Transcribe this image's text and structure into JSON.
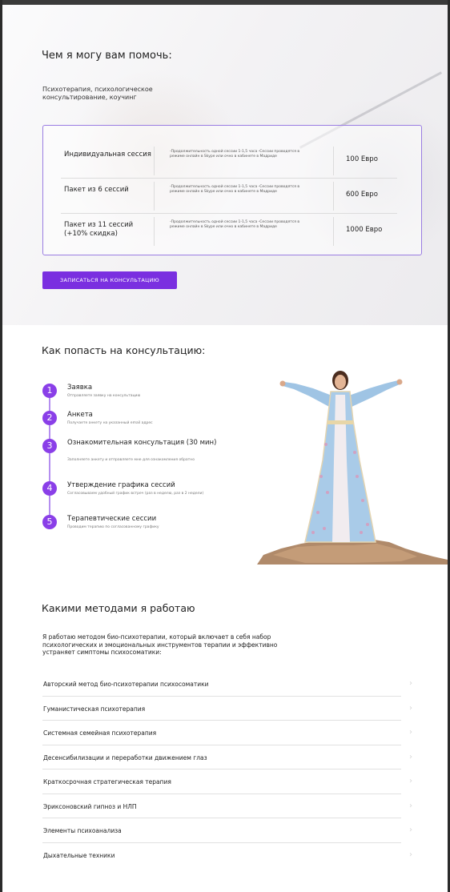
{
  "hero": {
    "title": "Чем я могу вам помочь:",
    "subtitle": "Психотерапия, психологическое консультирование, коучинг",
    "packages": [
      {
        "name": "Индивидуальная сессия",
        "desc": "-Продолжительность одной сессии 1-1,5 часа -Сессии проводятся в режиме онлайн в Skype или очно в кабинете в Мадриде",
        "price": "100 Евро"
      },
      {
        "name": "Пакет из 6 сессий",
        "desc": "-Продолжительность одной сессии 1-1,5 часа -Сессии проводятся в режиме онлайн в Skype или очно в кабинете в Мадриде",
        "price": "600 Евро"
      },
      {
        "name": "Пакет из 11 сессий (+10% скидка)",
        "desc": "-Продолжительность одной сессии 1-1,5 часа -Сессии проводятся в режиме онлайн в Skype или очно в кабинете в Мадриде",
        "price": "1000 Евро"
      }
    ],
    "cta_label": "ЗАПИСАТЬСЯ НА КОНСУЛЬТАЦИЮ"
  },
  "steps": {
    "title": "Как попасть на консультацию:",
    "items": [
      {
        "num": "1",
        "title": "Заявка",
        "desc": "Отправляете заявку на консультацию"
      },
      {
        "num": "2",
        "title": "Анкета",
        "desc": "Получаете анкету на указанный email адрес"
      },
      {
        "num": "3",
        "title": "Ознакомительная консультация (30 мин)",
        "desc": "Заполняете анкету и отправляете мне для ознакомления обратно"
      },
      {
        "num": "4",
        "title": "Утверждение графика сессий",
        "desc": "Согласовываем удобный график встреч (раз в неделю, раз в 2 недели)"
      },
      {
        "num": "5",
        "title": "Терапевтические сессии",
        "desc": "Проводим терапию по согласованному графику"
      }
    ]
  },
  "methods": {
    "title": "Какими методами я работаю",
    "intro": "Я работаю методом био-психотерапии, который включает в себя набор психологических и эмоциональных инструментов терапии и эффективно устраняет симптомы психосоматики:",
    "items": [
      "Авторский метод био-психотерапии психосоматики",
      "Гуманистическая психотерапия",
      "Системная семейная психотерапия",
      "Десенсибилизации и переработки движением глаз",
      "Краткосрочная стратегическая терапия",
      "Эриксоновский гипноз и НЛП",
      "Элементы психоанализа",
      "Дыхательные техники"
    ]
  },
  "colors": {
    "accent": "#7a2fe0",
    "step_circle": "#8a3fe8",
    "box_border": "#9a7de2"
  }
}
